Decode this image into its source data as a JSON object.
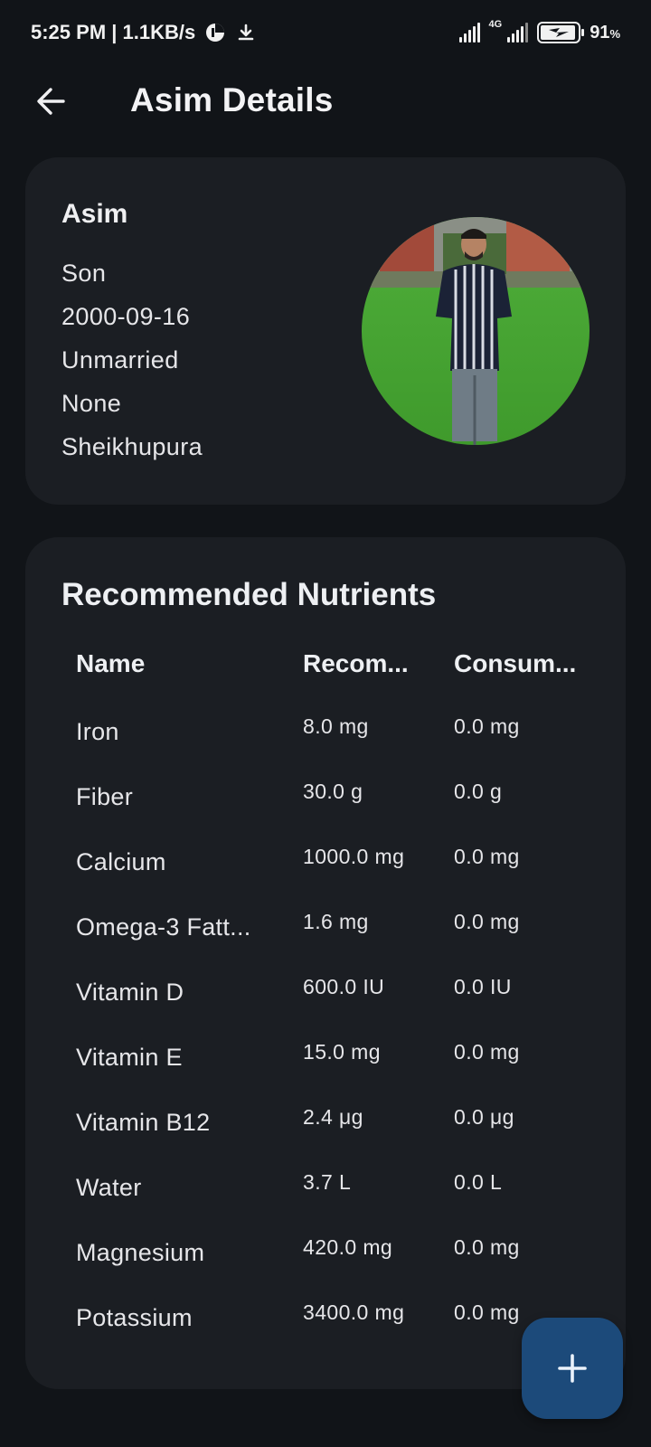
{
  "status_bar": {
    "time_speed": "5:25 PM | 1.1KB/s",
    "network_type": "4G",
    "battery_percent": "91",
    "battery_unit": "%"
  },
  "app_bar": {
    "title": "Asim Details"
  },
  "profile": {
    "name": "Asim",
    "relation": "Son",
    "dob": "2000-09-16",
    "marital_status": "Unmarried",
    "condition": "None",
    "city": "Sheikhupura"
  },
  "nutrients": {
    "title": "Recommended Nutrients",
    "headers": {
      "name": "Name",
      "recommended": "Recom...",
      "consumed": "Consum..."
    },
    "rows": [
      {
        "name": "Iron",
        "recommended": "8.0 mg",
        "consumed": "0.0 mg"
      },
      {
        "name": "Fiber",
        "recommended": "30.0 g",
        "consumed": "0.0 g"
      },
      {
        "name": "Calcium",
        "recommended": "1000.0 mg",
        "consumed": "0.0 mg"
      },
      {
        "name": "Omega-3 Fatt...",
        "recommended": "1.6 mg",
        "consumed": "0.0 mg"
      },
      {
        "name": "Vitamin D",
        "recommended": "600.0 IU",
        "consumed": "0.0 IU"
      },
      {
        "name": "Vitamin E",
        "recommended": "15.0 mg",
        "consumed": "0.0 mg"
      },
      {
        "name": "Vitamin B12",
        "recommended": "2.4 μg",
        "consumed": "0.0 μg"
      },
      {
        "name": "Water",
        "recommended": "3.7 L",
        "consumed": "0.0 L"
      },
      {
        "name": "Magnesium",
        "recommended": "420.0 mg",
        "consumed": "0.0 mg"
      },
      {
        "name": "Potassium",
        "recommended": "3400.0 mg",
        "consumed": "0.0 mg"
      }
    ]
  },
  "fab": {
    "icon": "plus-icon"
  }
}
